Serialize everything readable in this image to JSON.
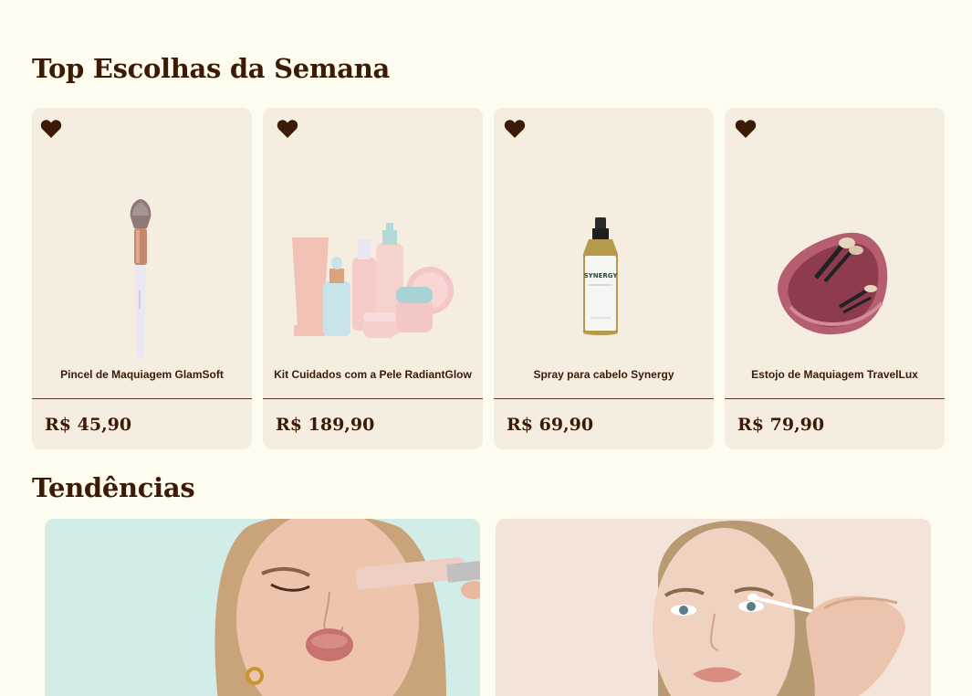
{
  "sections": {
    "top_picks_title": "Top Escolhas da Semana",
    "trends_title": "Tendências"
  },
  "products": [
    {
      "name": "Pincel de Maquiagem GlamSoft",
      "price": "R$ 45,90",
      "icon": "makeup-brush"
    },
    {
      "name": "Kit Cuidados com a Pele RadiantGlow",
      "price": "R$ 189,90",
      "icon": "skincare-kit"
    },
    {
      "name": "Spray para cabelo Synergy",
      "price": "R$ 69,90",
      "icon": "spray-bottle",
      "label_text": "SYNERGY"
    },
    {
      "name": "Estojo de Maquiagem TravelLux",
      "price": "R$ 79,90",
      "icon": "makeup-case"
    }
  ],
  "colors": {
    "page_bg": "#fefcee",
    "card_bg": "#f4ede0",
    "text_dark": "#3b1a06",
    "trend_1_bg": "#d2ece8",
    "trend_2_bg": "#f4e3d9"
  },
  "trends": [
    {
      "icon": "woman-applying-mascara-photo"
    },
    {
      "icon": "woman-with-cotton-swab-photo"
    }
  ]
}
